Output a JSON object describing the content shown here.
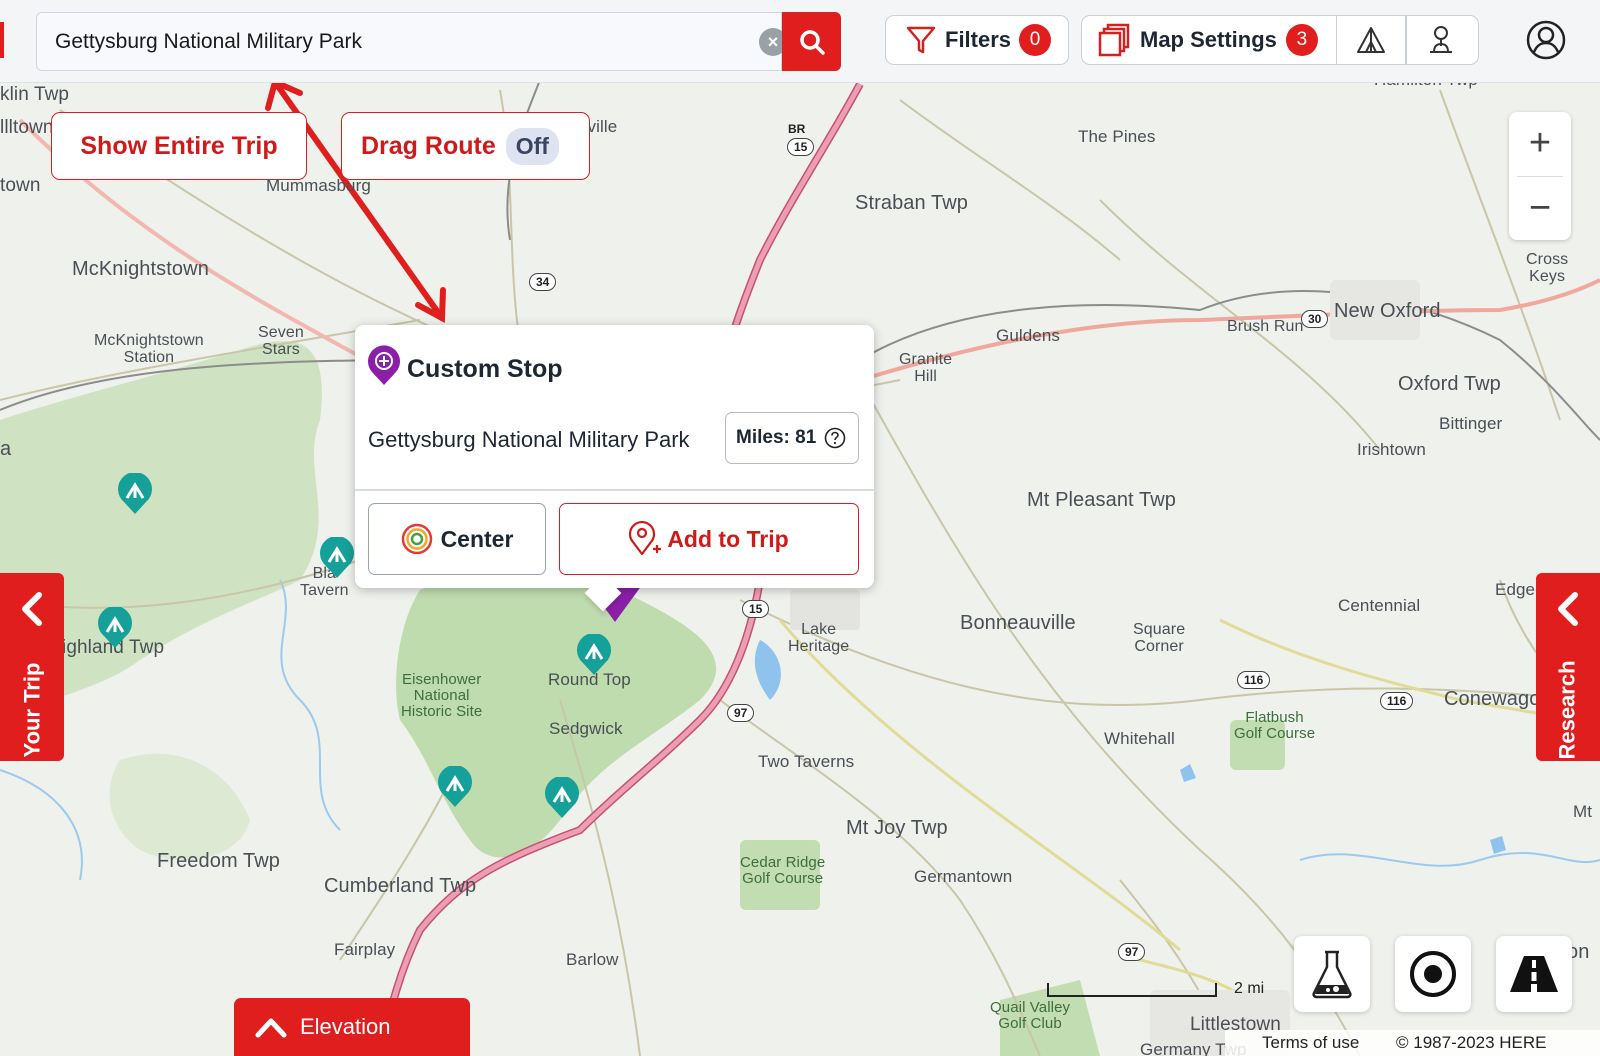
{
  "search": {
    "value": "Gettysburg National Military Park",
    "clear_icon": "clear-icon",
    "search_icon": "search-icon"
  },
  "toolbar": {
    "filters_label": "Filters",
    "filters_count": "0",
    "map_settings_label": "Map Settings",
    "map_settings_count": "3",
    "icons": [
      "filter-icon",
      "layers-icon",
      "tent-icon",
      "person-pin-icon",
      "account-icon"
    ]
  },
  "map_controls": {
    "show_entire_trip": "Show Entire Trip",
    "drag_route_label": "Drag Route",
    "drag_route_state": "Off",
    "zoom_in": "+",
    "zoom_out": "−",
    "your_trip": "Your Trip",
    "research": "Research",
    "elevation": "Elevation",
    "scale_label": "2 mi",
    "terms": "Terms of use",
    "copyright": "© 1987-2023 HERE",
    "tool_icons": [
      "flask-icon",
      "locate-icon",
      "road-icon"
    ]
  },
  "popup": {
    "title": "Custom Stop",
    "place": "Gettysburg National Military Park",
    "miles": "Miles: 81",
    "help_icon": "help-icon",
    "center_label": "Center",
    "add_label": "Add to Trip"
  },
  "map_labels": {
    "franklin": "klin Twp",
    "allstown": "llltown",
    "town": "town",
    "mummasburg": "Mummasburg",
    "nville": "nville",
    "mcknightstown": "McKnightstown",
    "mcknightstown_station": "McKnightstown\nStation",
    "seven_stars": "Seven\nStars",
    "straban": "Straban Twp",
    "the_pines": "The Pines",
    "hamilton": "Hamilton Twp",
    "cross_keys": "Cross\nKeys",
    "new_oxford": "New Oxford",
    "brush_run": "Brush Run",
    "guldens": "Guldens",
    "granite_hill": "Granite\nHill",
    "oxford_twp": "Oxford Twp",
    "bittinger": "Bittinger",
    "irishtown": "Irishtown",
    "mt_pleasant": "Mt Pleasant Twp",
    "a": "a",
    "black_horse_tavern": "Bla\nTavern",
    "highland": "ighland Twp",
    "edgegrove": "Edgegro",
    "centennial": "Centennial",
    "bonneauville": "Bonneauville",
    "square_corner": "Square\nCorner",
    "lake_heritage": "Lake\nHeritage",
    "round_top": "Round Top",
    "eisenhower": "Eisenhower\nNational\nHistoric Site",
    "sedgwick": "Sedgwick",
    "conewago": "Conewago",
    "flatbush": "Flatbush\nGolf Course",
    "whitehall": "Whitehall",
    "two_taverns": "Two Taverns",
    "mt_joy": "Mt Joy Twp",
    "germantown": "Germantown",
    "cedar_ridge": "Cedar Ridge\nGolf Course",
    "freedom": "Freedom Twp",
    "cumberland": "Cumberland Twp",
    "fairplay": "Fairplay",
    "barlow": "Barlow",
    "quail_valley": "Quail Valley\nGolf Club",
    "littlestown": "Littlestown",
    "mt": "Mt",
    "on": "on",
    "germany": "Germany Twp"
  },
  "route_shields": {
    "br": "BR",
    "us15_top": "15",
    "r34": "34",
    "r30": "30",
    "us15_mid": "15",
    "r97_a": "97",
    "r116_a": "116",
    "r116_b": "116",
    "r97_b": "97"
  },
  "colors": {
    "accent_red": "#e01e1e",
    "marker_purple": "#8b1fa8",
    "camp_teal": "#16a09a"
  }
}
